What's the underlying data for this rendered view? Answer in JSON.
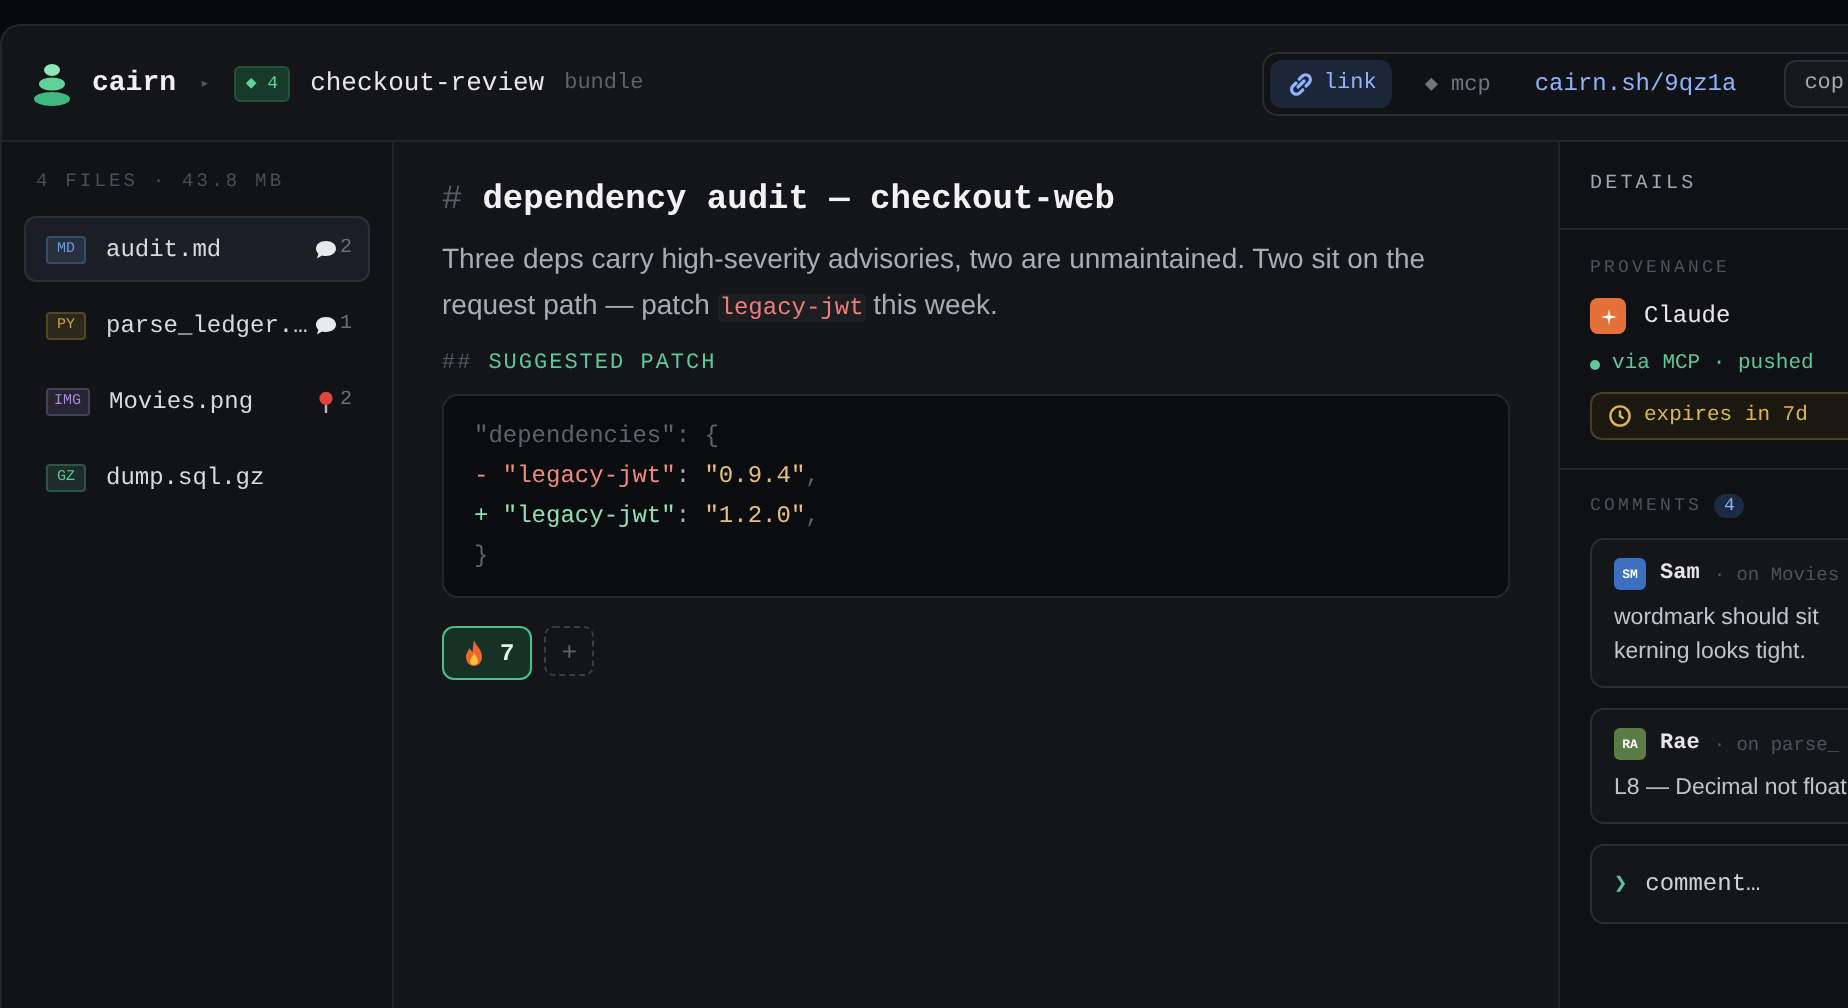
{
  "app": {
    "name": "cairn"
  },
  "breadcrumb": {
    "separator": "▸",
    "badge": "◆ 4",
    "title": "checkout-review",
    "kind_label": "bundle"
  },
  "share": {
    "modes": [
      {
        "label": "link",
        "selected": true
      },
      {
        "label": "◆ mcp",
        "selected": false
      }
    ],
    "url": "cairn.sh/9qz1a",
    "copy": "cop"
  },
  "sidebar": {
    "summary": "4 FILES · 43.8 MB",
    "files": [
      {
        "type": "MD",
        "color": "#6e9be0",
        "name": "audit.md",
        "selected": true,
        "marker": {
          "kind": "comment",
          "count": "2"
        }
      },
      {
        "type": "PY",
        "color": "#c9a43c",
        "name": "parse_ledger.…",
        "selected": false,
        "marker": {
          "kind": "comment",
          "count": "1"
        }
      },
      {
        "type": "IMG",
        "color": "#a98bd6",
        "name": "Movies.png",
        "selected": false,
        "marker": {
          "kind": "pin",
          "count": "2"
        }
      },
      {
        "type": "GZ",
        "color": "#5fc79a",
        "name": "dump.sql.gz",
        "selected": false
      }
    ]
  },
  "document": {
    "hash": "#",
    "title": "dependency audit — checkout-web",
    "summary": {
      "before": "Three deps carry high-severity advisories, two are unmaintained. Two sit on the request path — patch ",
      "code": "legacy-jwt",
      "after": " this week."
    },
    "section": {
      "marker": "##",
      "title": "SUGGESTED PATCH"
    },
    "code": [
      {
        "kind": "context",
        "text": "\"dependencies\": {"
      },
      {
        "kind": "removed",
        "sign": "-",
        "key": "\"legacy-jwt\"",
        "sep": ": ",
        "value": "\"0.9.4\"",
        "trail": ","
      },
      {
        "kind": "added",
        "sign": "+",
        "key": "\"legacy-jwt\"",
        "sep": ": ",
        "value": "\"1.2.0\"",
        "trail": ","
      },
      {
        "kind": "context",
        "text": "}"
      }
    ],
    "reactions": [
      {
        "count": "7",
        "selected": true
      }
    ],
    "add_reaction": "+"
  },
  "details": {
    "title": "DETAILS",
    "provenance": {
      "label": "PROVENANCE",
      "author": "Claude",
      "via": "via MCP · pushed",
      "expires": "expires in 7d"
    },
    "comments": {
      "label": "COMMENTS",
      "count": "4",
      "items": [
        {
          "initials": "SM",
          "color": "#3d6fc0",
          "author": "Sam",
          "target": "· on Movies",
          "text": "wordmark should sit\nkerning looks tight."
        },
        {
          "initials": "RA",
          "color": "#5b7d45",
          "author": "Rae",
          "target": "· on parse_",
          "text": "L8 — Decimal not float"
        }
      ]
    },
    "composer": {
      "prompt": "❯",
      "placeholder": "comment…"
    }
  }
}
